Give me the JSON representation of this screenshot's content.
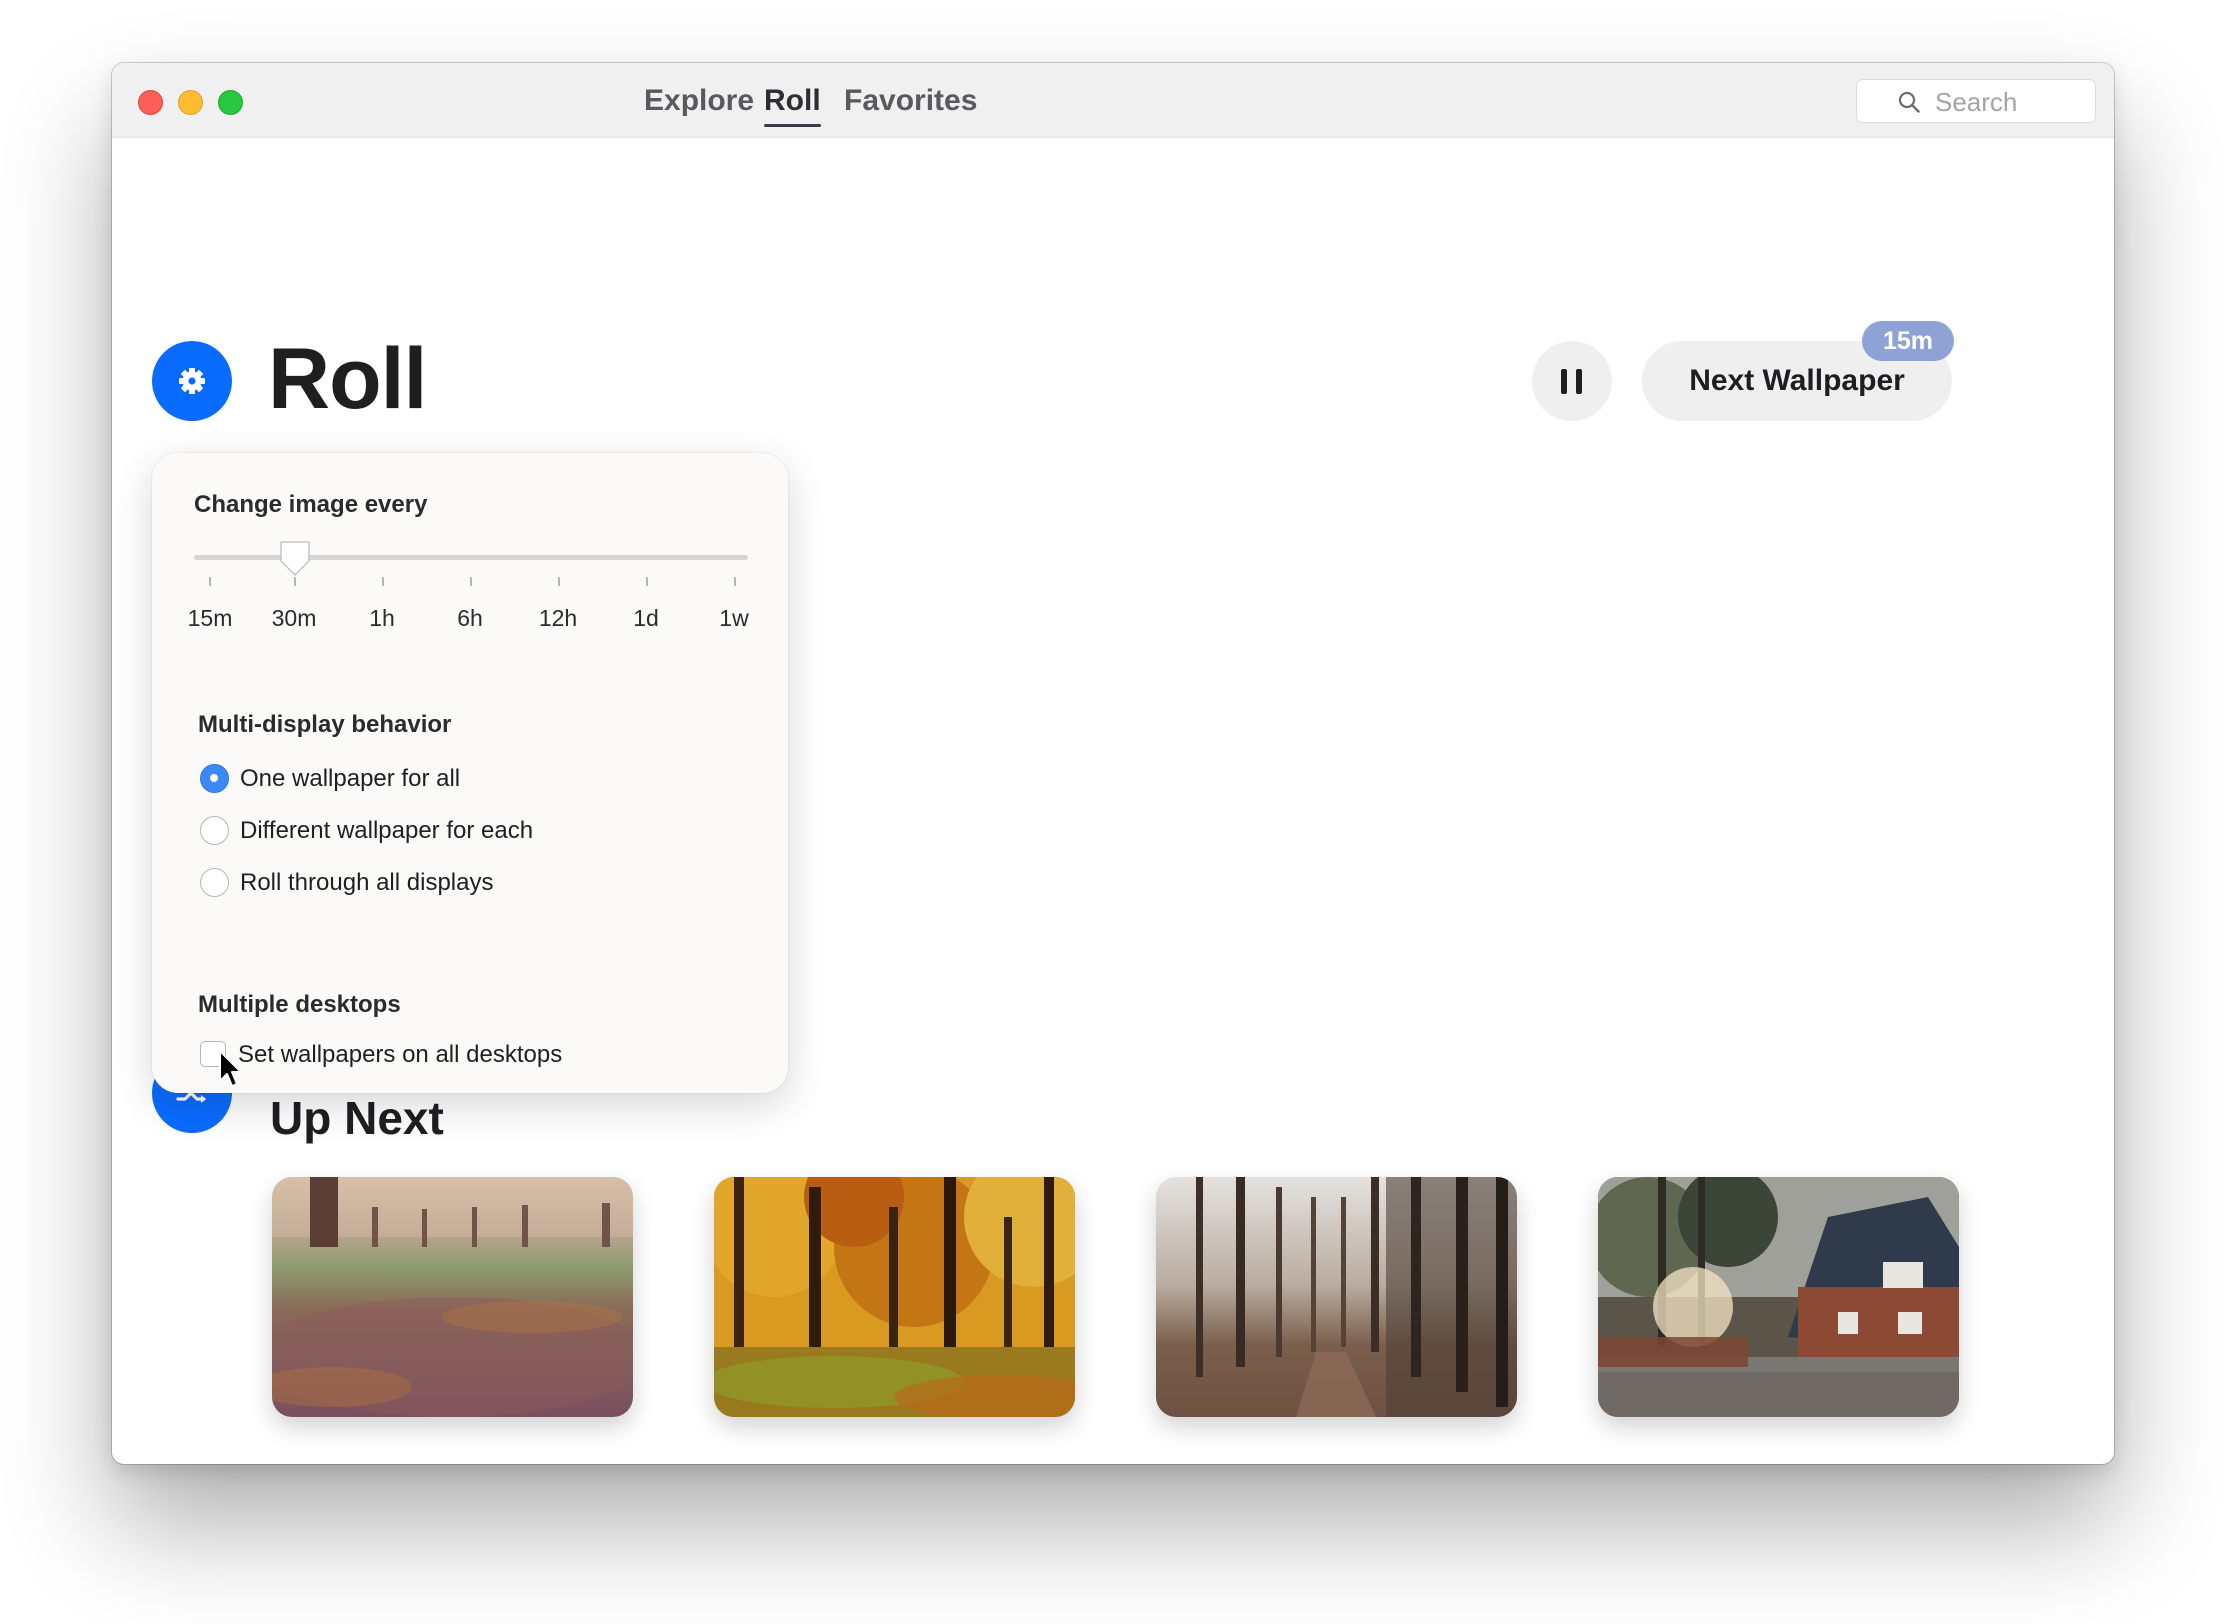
{
  "tabs": [
    {
      "label": "Explore",
      "active": false
    },
    {
      "label": "Roll",
      "active": true
    },
    {
      "label": "Favorites",
      "active": false
    }
  ],
  "search": {
    "placeholder": "Search"
  },
  "page": {
    "title": "Roll",
    "upnext_title": "Up Next"
  },
  "controls": {
    "next_label": "Next Wallpaper",
    "badge": "15m"
  },
  "settings": {
    "interval_label": "Change image every",
    "interval_options": [
      "15m",
      "30m",
      "1h",
      "6h",
      "12h",
      "1d",
      "1w"
    ],
    "interval_selected": "30m",
    "multi_display_label": "Multi-display behavior",
    "multi_display_options": [
      {
        "label": "One wallpaper for all",
        "selected": true
      },
      {
        "label": "Different wallpaper for each",
        "selected": false
      },
      {
        "label": "Roll through all displays",
        "selected": false
      }
    ],
    "desktops_label": "Multiple desktops",
    "desktops_checkbox": {
      "label": "Set wallpapers on all desktops",
      "checked": false
    }
  },
  "colors": {
    "accent": "#0a6cff",
    "badge": "#8ea2d6",
    "radio_on": "#3b89f5"
  },
  "thumbnails": [
    {
      "name": "autumn-path"
    },
    {
      "name": "golden-forest"
    },
    {
      "name": "bare-tree-avenue"
    },
    {
      "name": "brick-house"
    }
  ]
}
